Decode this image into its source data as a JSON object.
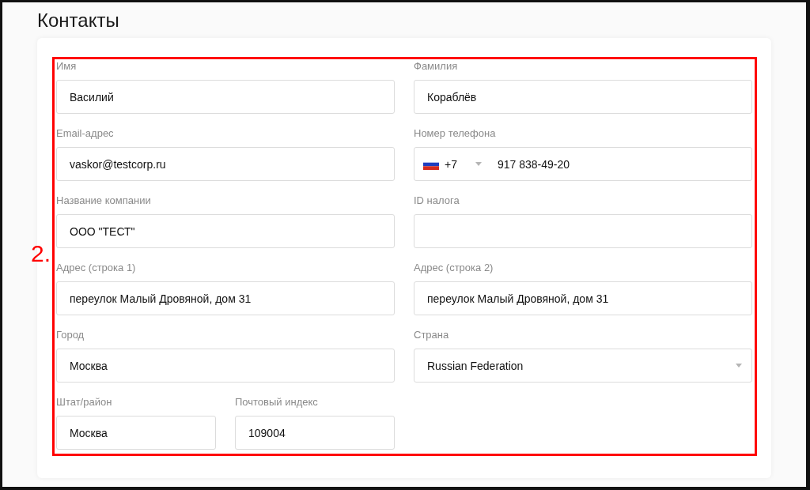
{
  "page_title": "Контакты",
  "annotation": {
    "label": "2."
  },
  "fields": [
    {
      "kind": "text",
      "label": "Имя",
      "value": "Василий"
    },
    {
      "kind": "text",
      "label": "Фамилия",
      "value": "Кораблёв"
    },
    {
      "kind": "text",
      "label": "Email-адрес",
      "value": "vaskor@testcorp.ru"
    },
    {
      "kind": "phone",
      "label": "Номер телефона",
      "country_code": "+7",
      "value": "917 838-49-20"
    },
    {
      "kind": "text",
      "label": "Название компании",
      "value": "ООО \"ТЕСТ\""
    },
    {
      "kind": "text",
      "label": "ID налога"
    },
    {
      "kind": "text",
      "label": "Адрес (строка 1)",
      "value": "переулок Малый Дровяной, дом 31"
    },
    {
      "kind": "text",
      "label": "Адрес (строка 2)",
      "value": "переулок Малый Дровяной, дом 31"
    },
    {
      "kind": "text",
      "label": "Город",
      "value": "Москва"
    },
    {
      "kind": "select",
      "label": "Страна",
      "value": "Russian Federation"
    },
    {
      "kind": "short",
      "label": "Штат/район",
      "value": "Москва"
    },
    {
      "kind": "short",
      "label": "Почтовый индекс",
      "value": "109004"
    }
  ]
}
